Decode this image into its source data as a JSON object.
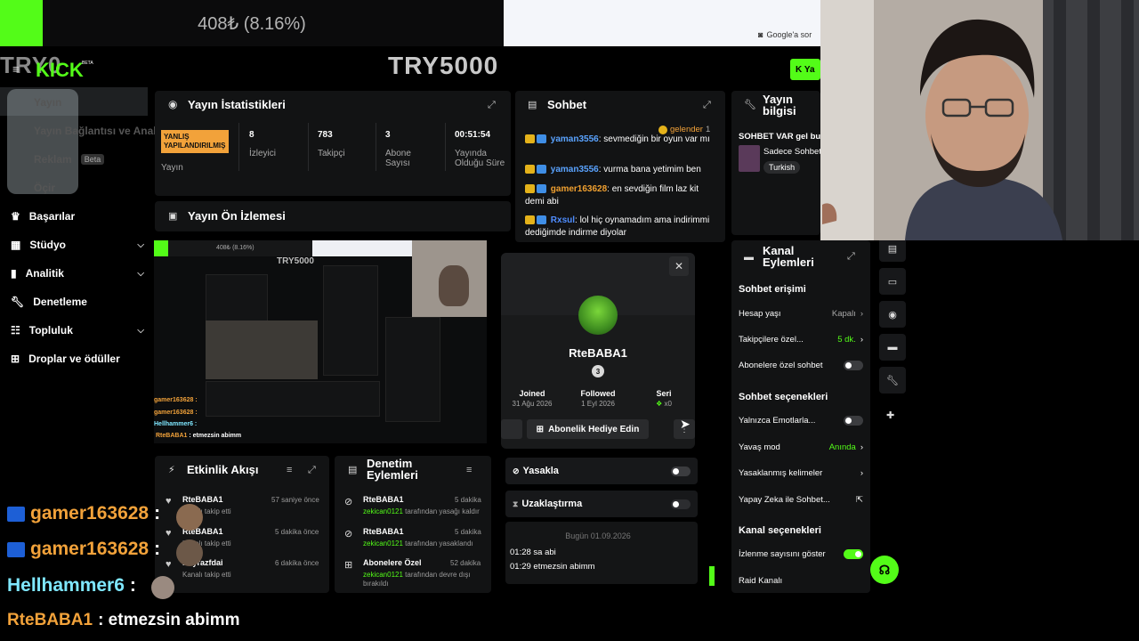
{
  "overlay": {
    "price_text": "408₺ (8.16%)",
    "google_chip": "Google'a sor",
    "try_left": "TRY0",
    "try_center": "TRY5000",
    "kick_logo": "KICK",
    "kick_beta": "BETA",
    "live_button": "K Ya"
  },
  "sidebar": {
    "faded_items": [
      {
        "label": "Yayın"
      },
      {
        "label": "Yayın Bağlantısı ve Anahtarı"
      },
      {
        "label": "Reklam",
        "badge": "Beta"
      },
      {
        "label": "Öçir"
      }
    ],
    "items": [
      {
        "label": "Başarılar",
        "icon": "trophy-icon"
      },
      {
        "label": "Stüdyo",
        "icon": "studio-icon",
        "expandable": true
      },
      {
        "label": "Analitik",
        "icon": "chart-icon",
        "expandable": true
      },
      {
        "label": "Denetleme",
        "icon": "wrench-icon"
      },
      {
        "label": "Topluluk",
        "icon": "community-icon",
        "expandable": true
      },
      {
        "label": "Droplar ve ödüller",
        "icon": "gift-icon"
      }
    ]
  },
  "stats": {
    "title": "Yayın İstatistikleri",
    "status_badge": "YANLIŞ YAPILANDIRILMIŞ",
    "status_label": "Yayın",
    "columns": [
      {
        "value": "8",
        "label": "İzleyici"
      },
      {
        "value": "783",
        "label": "Takipçi"
      },
      {
        "value": "3",
        "label": "Abone Sayısı"
      },
      {
        "value": "00:51:54",
        "label": "Yayında Olduğu Süre"
      }
    ]
  },
  "preview": {
    "title": "Yayın Ön İzlemesi",
    "mini_price": "408₺ (8.16%)",
    "mini_try": "TRY5000",
    "mini_lines": [
      {
        "user": "gamer163628 :"
      },
      {
        "user": "gamer163628 :"
      },
      {
        "user": "Hellhammer6 :"
      },
      {
        "user": "RteBABA1",
        "text": ": etmezsin abimm"
      }
    ]
  },
  "chat": {
    "title": "Sohbet",
    "gelender_label": "gelender",
    "gelender_count": "1",
    "messages": [
      {
        "user": "yaman3556",
        "text": ": sevmediğin bir oyun var mı"
      },
      {
        "user": "yaman3556",
        "text": ": vurma bana yetimim ben"
      },
      {
        "user": "gamer163628",
        "text": ": en sevdiğin film laz kit demi abi"
      },
      {
        "user": "Rxsul",
        "text": ": lol hiç oynamadım ama indirimmi dediğimde indirme diyolar"
      }
    ]
  },
  "user_card": {
    "username": "RteBABA1",
    "level": "3",
    "joined_label": "Joined",
    "joined_value": "31 Ağu 2026",
    "followed_label": "Followed",
    "followed_value": "1 Eyl 2026",
    "streak_label": "Seri",
    "streak_value": "x0",
    "gift_button": "Abonelik Hediye Edin",
    "ban_label": "Yasakla",
    "timeout_label": "Uzaklaştırma",
    "date_divider": "Bugün 01.09.2026",
    "history": [
      {
        "time": "01:28",
        "text": "sa abi"
      },
      {
        "time": "01:29",
        "text": "etmezsin abimm"
      }
    ]
  },
  "stream_info": {
    "title": "Yayın bilgisi",
    "stream_title": "SOHBET VAR gel bu",
    "category": "Sadece Sohbet",
    "language": "Turkish"
  },
  "channel_actions": {
    "title": "Kanal Eylemleri",
    "chat_access_head": "Sohbet erişimi",
    "account_age_label": "Hesap yaşı",
    "account_age_value": "Kapalı",
    "followers_only_label": "Takipçilere özel...",
    "followers_only_value": "5 dk.",
    "subs_only_label": "Abonelere özel sohbet",
    "chat_options_head": "Sohbet seçenekleri",
    "emotes_only_label": "Yalnızca Emotlarla...",
    "slow_mode_label": "Yavaş mod",
    "slow_mode_value": "Anında",
    "banned_words_label": "Yasaklanmış kelimeler",
    "ai_chat_label": "Yapay Zeka ile Sohbet...",
    "channel_options_head": "Kanal seçenekleri",
    "show_viewers_label": "İzlenme sayısını göster",
    "raid_label": "Raid Kanalı"
  },
  "activity": {
    "title": "Etkinlik Akışı",
    "events": [
      {
        "name": "RteBABA1",
        "sub": "Kanalı takip etti",
        "time": "57 saniye önce"
      },
      {
        "name": "RteBABA1",
        "sub": "Kanalı takip etti",
        "time": "5 dakika önce"
      },
      {
        "name": "Poyrazfdai",
        "sub": "Kanalı takip etti",
        "time": "6 dakika önce"
      }
    ]
  },
  "modlog": {
    "title": "Denetim Eylemleri",
    "events": [
      {
        "name": "RteBABA1",
        "actor": "zekican0121",
        "sub": "tarafından yasağı kaldır",
        "time": "5 dakika"
      },
      {
        "name": "RteBABA1",
        "actor": "zekican0121",
        "sub": "tarafından yasaklandı",
        "time": "5 dakika"
      },
      {
        "name": "Abonelere Özel",
        "actor": "zekican0121",
        "sub": "tarafından devre dışı bırakıldı",
        "time": "52 dakika"
      }
    ]
  },
  "big_chat": [
    {
      "user": "gamer163628",
      "sep": ":",
      "color": "#f2a23a"
    },
    {
      "user": "gamer163628",
      "sep": ":",
      "color": "#f2a23a"
    },
    {
      "user": "Hellhammer6",
      "sep": ":",
      "color": "#7fe7ff"
    },
    {
      "user": "RteBABA1",
      "sep": ": etmezsin abimm",
      "color": "#f2a23a"
    }
  ],
  "colors": {
    "kick_green": "#53fc18",
    "panel_bg": "#121314",
    "warning_orange": "#f2a23a"
  }
}
